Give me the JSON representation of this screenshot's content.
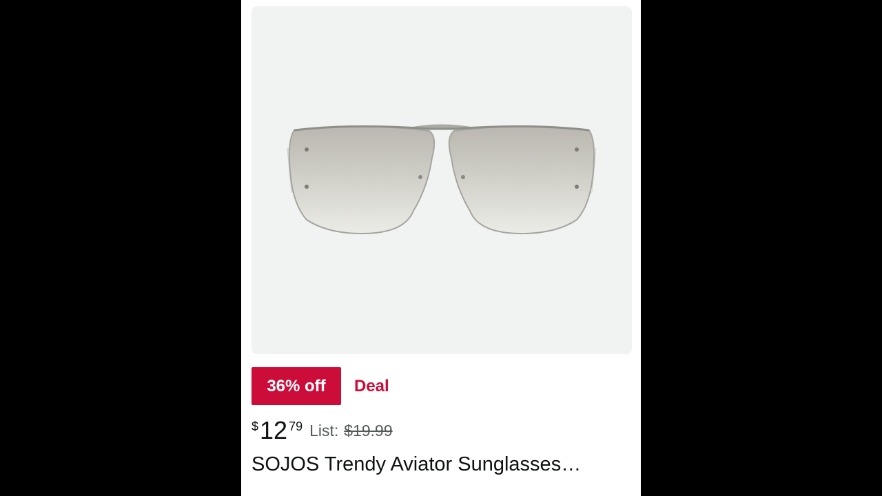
{
  "product": {
    "image_alt": "SOJOS aviator sunglasses product photo",
    "discount_badge": "36% off",
    "deal_label": "Deal",
    "price": {
      "symbol": "$",
      "whole": "12",
      "fraction": "79",
      "list_label": "List:",
      "list_price": "$19.99"
    },
    "title": "SOJOS Trendy Aviator Sunglasses…"
  },
  "colors": {
    "page_background": "#000000",
    "card_background": "#ffffff",
    "image_background": "#f1f2f2",
    "deal_red": "#cc0c39",
    "text_primary": "#0f1111",
    "text_secondary": "#565959"
  }
}
